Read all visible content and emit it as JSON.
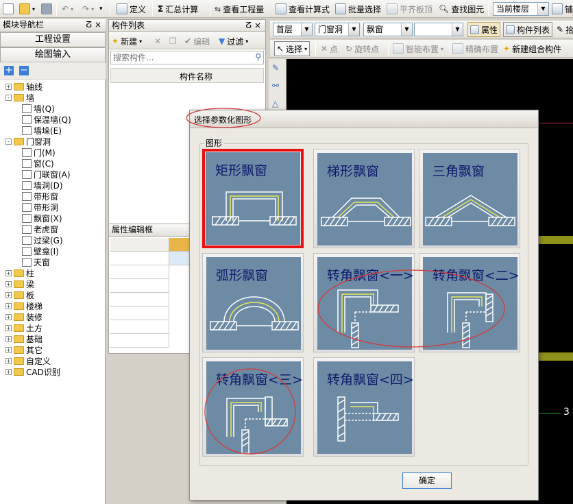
{
  "toolbar1": {
    "define": "定义",
    "summary_calc": "汇总计算",
    "view_qty": "查看工程量",
    "view_formula": "查看计算式",
    "batch_select": "批量选择",
    "align_top": "平齐板顶",
    "find_element": "查找图元",
    "floor_combo": "当前楼层",
    "more": "铺"
  },
  "toolbar2": {
    "floor": "首层",
    "category": "门窗洞",
    "element": "飘窗",
    "prop_button": "属性",
    "list_button": "构件列表",
    "more": "拾"
  },
  "toolbar3": {
    "select": "选择",
    "point": "点",
    "rotate_point": "旋转点",
    "smart_layout": "智能布置",
    "precise_layout": "精确布置",
    "new_combo": "新建组合构件"
  },
  "nav": {
    "title": "模块导航栏",
    "project_settings": "工程设置",
    "drawing_input": "绘图输入",
    "tree": [
      {
        "label": "轴线",
        "type": "folder",
        "expand": "+"
      },
      {
        "label": "墙",
        "type": "folder",
        "expand": "-"
      },
      {
        "label": "墙(Q)",
        "type": "leaf"
      },
      {
        "label": "保温墙(Q)",
        "type": "leaf"
      },
      {
        "label": "墙垛(E)",
        "type": "leaf"
      },
      {
        "label": "门窗洞",
        "type": "folder",
        "expand": "-"
      },
      {
        "label": "门(M)",
        "type": "leaf"
      },
      {
        "label": "窗(C)",
        "type": "leaf"
      },
      {
        "label": "门联窗(A)",
        "type": "leaf"
      },
      {
        "label": "墙洞(D)",
        "type": "leaf"
      },
      {
        "label": "带形窗",
        "type": "leaf"
      },
      {
        "label": "带形洞",
        "type": "leaf"
      },
      {
        "label": "飘窗(X)",
        "type": "leaf"
      },
      {
        "label": "老虎窗",
        "type": "leaf"
      },
      {
        "label": "过梁(G)",
        "type": "leaf"
      },
      {
        "label": "壁龛(I)",
        "type": "leaf"
      },
      {
        "label": "天窗",
        "type": "leaf"
      },
      {
        "label": "柱",
        "type": "folder",
        "expand": "+"
      },
      {
        "label": "梁",
        "type": "folder",
        "expand": "+"
      },
      {
        "label": "板",
        "type": "folder",
        "expand": "+"
      },
      {
        "label": "楼梯",
        "type": "folder",
        "expand": "+"
      },
      {
        "label": "装修",
        "type": "folder",
        "expand": "+"
      },
      {
        "label": "土方",
        "type": "folder",
        "expand": "+"
      },
      {
        "label": "基础",
        "type": "folder",
        "expand": "+"
      },
      {
        "label": "其它",
        "type": "folder",
        "expand": "+"
      },
      {
        "label": "自定义",
        "type": "folder",
        "expand": "+"
      },
      {
        "label": "CAD识别",
        "type": "folder",
        "expand": "+"
      }
    ]
  },
  "component_list": {
    "title": "构件列表",
    "new_label": "新建",
    "edit_label": "编辑",
    "filter_label": "过滤",
    "search_placeholder": "搜索构件...",
    "column_name": "构件名称"
  },
  "property_panel": {
    "title": "属性编辑框"
  },
  "canvas": {
    "label_3": "3"
  },
  "dialog": {
    "title": "选择参数化图形",
    "group_label": "图形",
    "ok_button": "确定",
    "shapes": [
      {
        "label": "矩形飘窗",
        "selected": true
      },
      {
        "label": "梯形飘窗",
        "selected": false
      },
      {
        "label": "三角飘窗",
        "selected": false
      },
      {
        "label": "弧形飘窗",
        "selected": false
      },
      {
        "label": "转角飘窗<一>",
        "selected": false
      },
      {
        "label": "转角飘窗<二>",
        "selected": false
      },
      {
        "label": "转角飘窗<三>",
        "selected": false
      },
      {
        "label": "转角飘窗<四>",
        "selected": false
      }
    ]
  },
  "colors": {
    "shape_bg": "#6e8ba5",
    "shape_label": "#0e1a6b",
    "selected_border": "#e81010",
    "annotation_circle": "#d23b3b",
    "canvas_bg": "#000000"
  }
}
